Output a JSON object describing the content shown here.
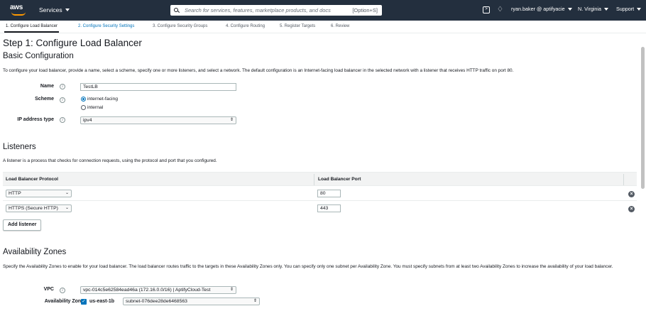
{
  "topnav": {
    "logo_text": "aws",
    "services_label": "Services",
    "search_placeholder": "Search for services, features, marketplace products, and docs",
    "search_shortcut": "[Option+S]",
    "cloudshell_icon": "cloudshell-icon",
    "bell_icon": "bell-icon",
    "account_label": "ryan.baker @ aptifyacie",
    "region_label": "N. Virginia",
    "support_label": "Support"
  },
  "steps": [
    {
      "label": "1. Configure Load Balancer",
      "state": "active"
    },
    {
      "label": "2. Configure Security Settings",
      "state": "next"
    },
    {
      "label": "3. Configure Security Groups",
      "state": "pending"
    },
    {
      "label": "4. Configure Routing",
      "state": "pending"
    },
    {
      "label": "5. Register Targets",
      "state": "pending"
    },
    {
      "label": "6. Review",
      "state": "pending"
    }
  ],
  "page": {
    "title": "Step 1: Configure Load Balancer",
    "basic_heading": "Basic Configuration",
    "basic_desc": "To configure your load balancer, provide a name, select a scheme, specify one or more listeners, and select a network. The default configuration is an Internet-facing load balancer in the selected network with a listener that receives HTTP traffic on port 80."
  },
  "basic": {
    "name_label": "Name",
    "name_value": "TestLB",
    "scheme_label": "Scheme",
    "scheme_options": [
      "internet-facing",
      "internal"
    ],
    "scheme_selected": "internet-facing",
    "ip_label": "IP address type",
    "ip_value": "ipv4",
    "info_glyph": "i"
  },
  "listeners": {
    "heading": "Listeners",
    "desc": "A listener is a process that checks for connection requests, using the protocol and port that you configured.",
    "col_protocol": "Load Balancer Protocol",
    "col_port": "Load Balancer Port",
    "rows": [
      {
        "protocol": "HTTP",
        "port": "80"
      },
      {
        "protocol": "HTTPS (Secure HTTP)",
        "port": "443"
      }
    ],
    "remove_glyph": "×",
    "add_button": "Add listener"
  },
  "az": {
    "heading": "Availability Zones",
    "desc": "Specify the Availability Zones to enable for your load balancer. The load balancer routes traffic to the targets in these Availability Zones only. You can specify only one subnet per Availability Zone. You must specify subnets from at least two Availability Zones to increase the availability of your load balancer.",
    "vpc_label": "VPC",
    "vpc_value": "vpc-014c5e62584ead46a (172.16.0.0/16) | AptifyCloud-Test",
    "zones_label": "Availability Zones",
    "zone_name": "us-east-1b",
    "zone_checked": true,
    "subnet_value": "subnet-076dee28de6468563"
  }
}
